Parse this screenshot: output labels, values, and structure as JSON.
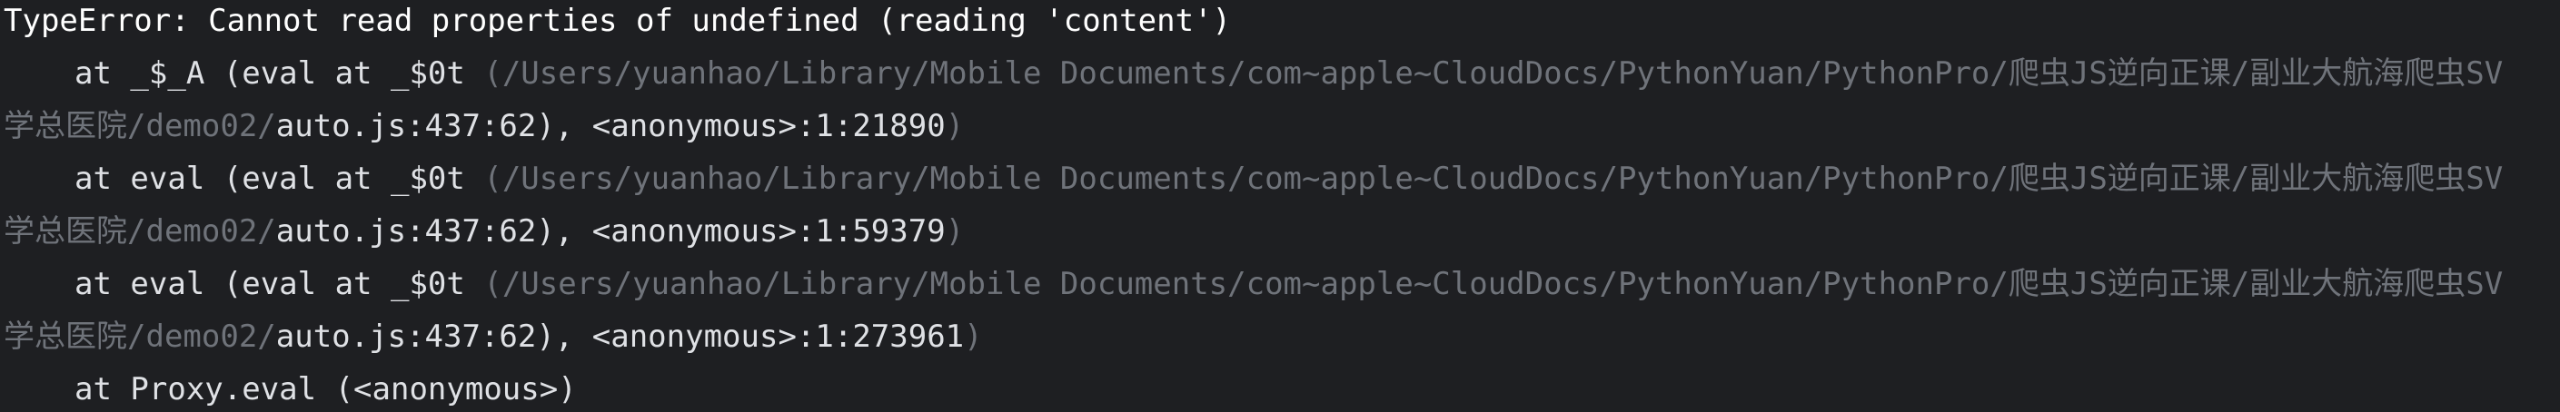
{
  "console": {
    "error_header": "TypeError: Cannot read properties of undefined (reading 'content')",
    "frames": [
      {
        "prefix": "at _$_A (eval at _$0t ",
        "path_open": "(/Users/yuanhao/Library/Mobile Documents/com~apple~CloudDocs/PythonYuan/PythonPro/爬虫JS逆向正课/副业大航海爬虫SV",
        "path_cont": "学总医院/demo02/",
        "location": "auto.js:437:62), <anonymous>:1:21890",
        "close": ")"
      },
      {
        "prefix": "at eval (eval at _$0t ",
        "path_open": "(/Users/yuanhao/Library/Mobile Documents/com~apple~CloudDocs/PythonYuan/PythonPro/爬虫JS逆向正课/副业大航海爬虫SV",
        "path_cont": "学总医院/demo02/",
        "location": "auto.js:437:62), <anonymous>:1:59379",
        "close": ")"
      },
      {
        "prefix": "at eval (eval at _$0t ",
        "path_open": "(/Users/yuanhao/Library/Mobile Documents/com~apple~CloudDocs/PythonYuan/PythonPro/爬虫JS逆向正课/副业大航海爬虫SV",
        "path_cont": "学总医院/demo02/",
        "location": "auto.js:437:62), <anonymous>:1:273961",
        "close": ")"
      }
    ],
    "last_frame": "at Proxy.eval (<anonymous>)",
    "colors": {
      "background": "#1e1f22",
      "text": "#dfe1e5",
      "dim_path": "#6f737a"
    }
  }
}
